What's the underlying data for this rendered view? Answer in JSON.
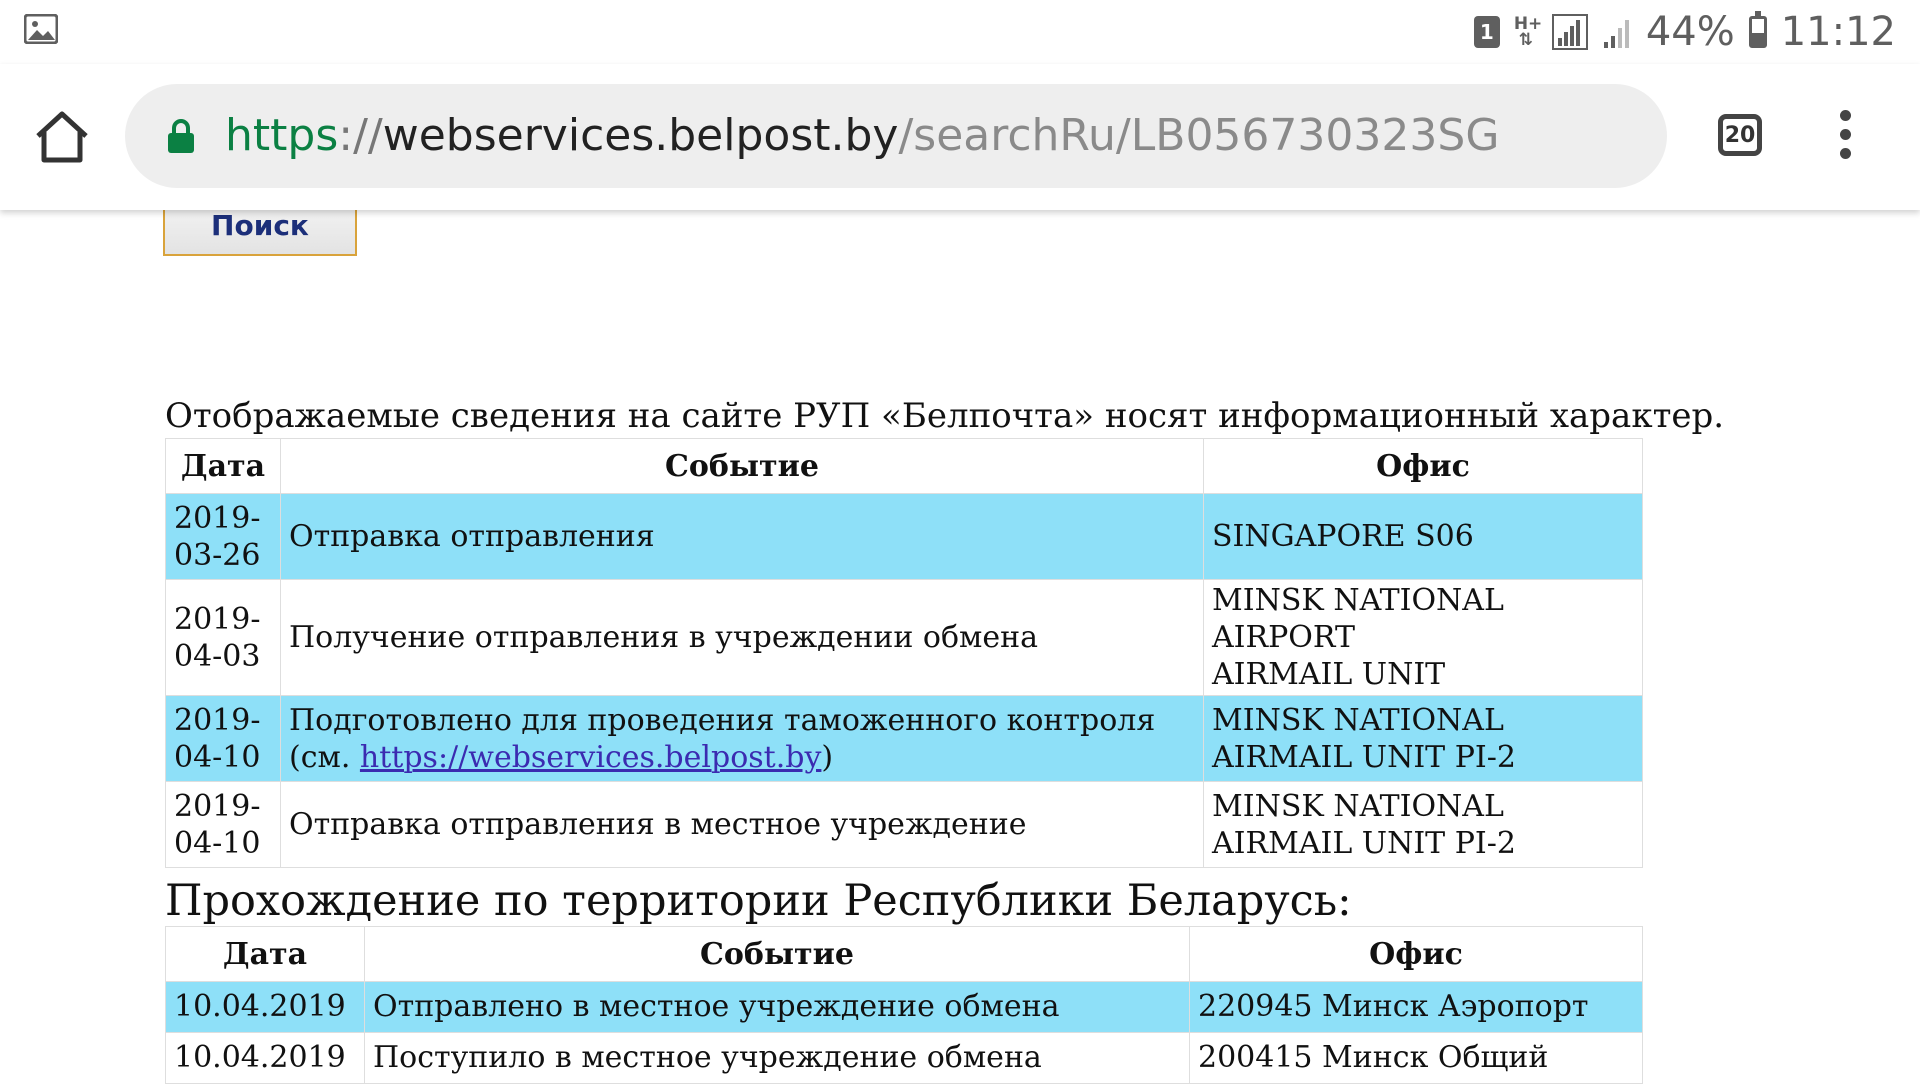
{
  "status_bar": {
    "gallery_icon": "gallery-icon",
    "sim_label": "1",
    "network_label": "H+",
    "battery": "44%",
    "battery_level": 0.44,
    "time": "11:12"
  },
  "browser": {
    "url_scheme": "https",
    "url_sep": "://",
    "url_host": "webservices.belpost.by",
    "url_path": "/searchRu/LB056730323SG",
    "tab_count": "20",
    "accent_secure": "#0b8043"
  },
  "page": {
    "search_button": "Поиск",
    "notice": "Отображаемые сведения на сайте РУП «Белпочта» носят информационный характер.",
    "table1": {
      "headers": [
        "Дата",
        "Событие",
        "Офис"
      ],
      "rows": [
        {
          "date_line1": "2019-",
          "date_line2": "03-26",
          "event": "Отправка отправления",
          "event_line2": "",
          "office_line1": "SINGAPORE S06",
          "office_line2": ""
        },
        {
          "date_line1": "2019-",
          "date_line2": "04-03",
          "event": "Получение отправления в учреждении обмена",
          "event_line2": "",
          "office_line1": "MINSK NATIONAL AIRPORT",
          "office_line2": "AIRMAIL UNIT"
        },
        {
          "date_line1": "2019-",
          "date_line2": "04-10",
          "event": "Подготовлено для проведения таможенного контроля",
          "event_line2_prefix": "(см. ",
          "event_link": "https://webservices.belpost.by",
          "event_line2_suffix": ")",
          "office_line1": "MINSK NATIONAL",
          "office_line2": "AIRMAIL UNIT PI-2"
        },
        {
          "date_line1": "2019-",
          "date_line2": "04-10",
          "event": "Отправка отправления в местное учреждение",
          "event_line2": "",
          "office_line1": "MINSK NATIONAL",
          "office_line2": "AIRMAIL UNIT PI-2"
        }
      ]
    },
    "section_title": "Прохождение по территории Республики Беларусь:",
    "table2": {
      "headers": [
        "Дата",
        "Событие",
        "Офис"
      ],
      "rows": [
        {
          "date": "10.04.2019",
          "event": "Отправлено в местное учреждение обмена",
          "office": "220945 Минск Аэропорт"
        },
        {
          "date": "10.04.2019",
          "event": "Поступило в местное учреждение обмена",
          "office": "200415 Минск Общий"
        }
      ]
    },
    "highlight_color": "#8ee0f8"
  }
}
